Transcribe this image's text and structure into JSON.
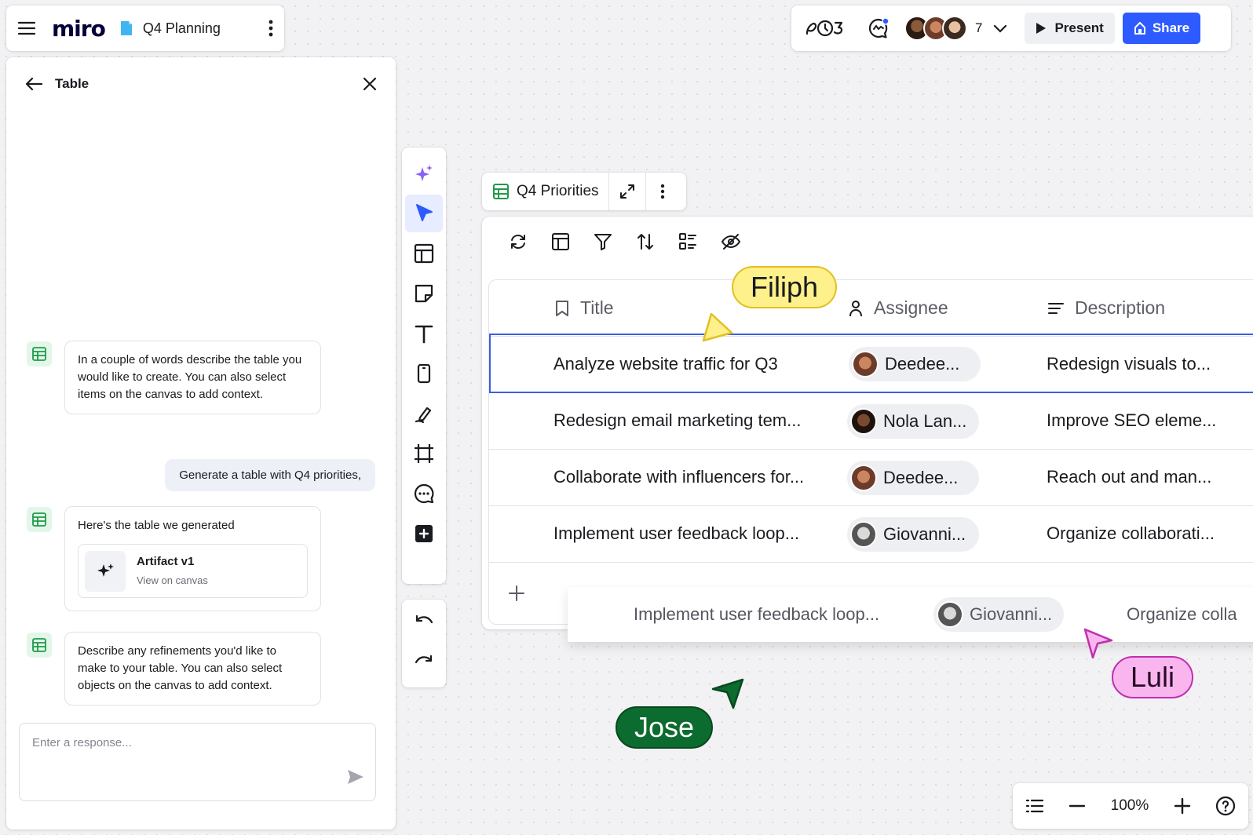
{
  "topbar": {
    "logo": "miro",
    "board_name": "Q4 Planning"
  },
  "header_right": {
    "collaborator_count": "7",
    "present_label": "Present",
    "share_label": "Share"
  },
  "panel": {
    "title": "Table",
    "messages": [
      {
        "text": "In a couple of words describe the table you would like to create. You can also select items on the canvas to add context."
      },
      {
        "text": "Generate a table with Q4 priorities,"
      },
      {
        "text": "Here's the table we generated",
        "artifact_title": "Artifact v1",
        "artifact_sub": "View on canvas"
      },
      {
        "text": "Describe any refinements you'd like to make to your table. You can also select objects on the canvas to add context."
      }
    ],
    "response_placeholder": "Enter a response..."
  },
  "table": {
    "name": "Q4 Priorities",
    "columns": [
      "Title",
      "Assignee",
      "Description"
    ],
    "rows": [
      {
        "title": "Analyze website traffic for Q3",
        "assignee": "Deedee...",
        "description": "Redesign visuals to..."
      },
      {
        "title": "Redesign email marketing tem...",
        "assignee": "Nola Lan...",
        "description": "Improve SEO eleme..."
      },
      {
        "title": "Collaborate with influencers for...",
        "assignee": "Deedee...",
        "description": "Reach out and man..."
      },
      {
        "title": "Implement user feedback loop...",
        "assignee": "Giovanni...",
        "description": "Organize collaborati..."
      }
    ],
    "dragged_row": {
      "title": "Implement user feedback loop...",
      "assignee": "Giovanni...",
      "description": "Organize colla"
    }
  },
  "cursors": [
    {
      "name": "Filiph",
      "color": "#fef08a"
    },
    {
      "name": "Luli",
      "color": "#f9b6ee"
    },
    {
      "name": "Jose",
      "color": "#0c6b2e"
    }
  ],
  "zoom": {
    "level": "100%"
  },
  "colors": {
    "accent": "#2d5bff",
    "ai_purple": "#7b5cf0",
    "table_green": "#1f9a4a"
  }
}
